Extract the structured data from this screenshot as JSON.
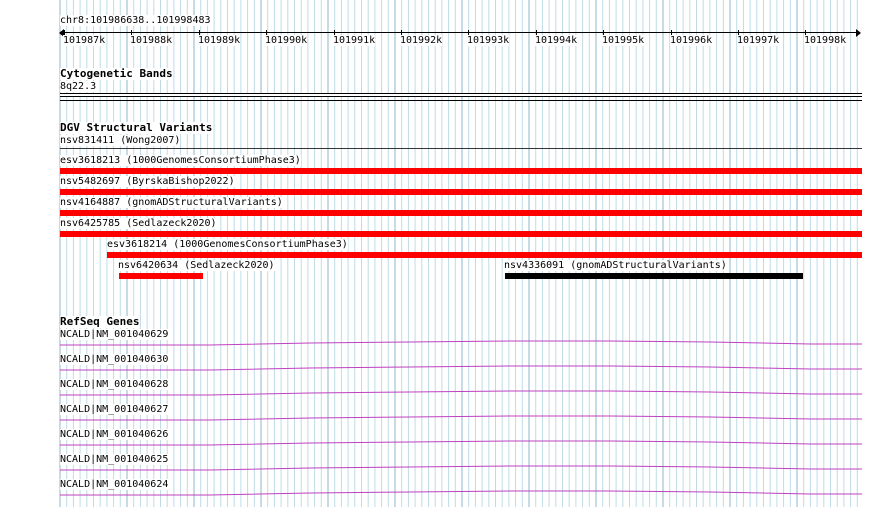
{
  "ruler": {
    "location": "chr8:101986638..101998483",
    "ticks": [
      "101987k",
      "101988k",
      "101989k",
      "101990k",
      "101991k",
      "101992k",
      "101993k",
      "101994k",
      "101995k",
      "101996k",
      "101997k",
      "101998k"
    ]
  },
  "cytobands": {
    "title": "Cytogenetic Bands",
    "band": "8q22.3"
  },
  "dgv": {
    "title": "DGV Structural Variants",
    "features": [
      {
        "label": "nsv831411 (Wong2007)",
        "color": "#ffffff"
      },
      {
        "label": "esv3618213 (1000GenomesConsortiumPhase3)",
        "color": "#ff0000"
      },
      {
        "label": "nsv5482697 (ByrskaBishop2022)",
        "color": "#ff0000"
      },
      {
        "label": "nsv4164887 (gnomADStructuralVariants)",
        "color": "#ff0000"
      },
      {
        "label": "nsv6425785 (Sedlazeck2020)",
        "color": "#ff0000"
      },
      {
        "label": "esv3618214 (1000GenomesConsortiumPhase3)",
        "color": "#ff0000"
      },
      {
        "label": "nsv6420634 (Sedlazeck2020)",
        "color": "#ff0000"
      },
      {
        "label": "nsv4336091 (gnomADStructuralVariants)",
        "color": "#000000"
      }
    ]
  },
  "refseq": {
    "title": "RefSeq Genes",
    "line_color": "#c040c0",
    "genes": [
      "NCALD|NM_001040629",
      "NCALD|NM_001040630",
      "NCALD|NM_001040628",
      "NCALD|NM_001040627",
      "NCALD|NM_001040626",
      "NCALD|NM_001040625",
      "NCALD|NM_001040624"
    ]
  }
}
